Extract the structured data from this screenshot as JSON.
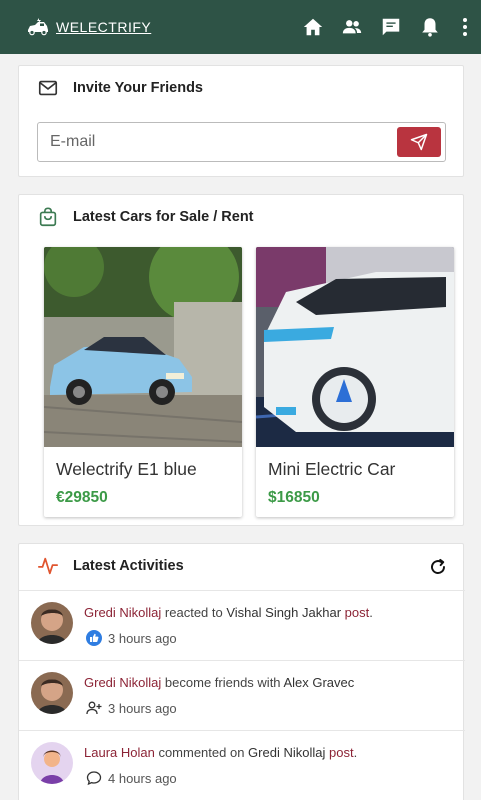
{
  "brand": {
    "name": "WELECTRIFY",
    "logo": "electric-car-logo"
  },
  "nav": {
    "icons": [
      "home-icon",
      "friends-icon",
      "messages-icon",
      "notifications-icon",
      "more-vertical-icon"
    ]
  },
  "invite": {
    "title": "Invite Your Friends",
    "icon": "envelope-icon",
    "email_placeholder": "E-mail",
    "send_icon": "send-icon"
  },
  "cars": {
    "title": "Latest Cars for Sale / Rent",
    "icon": "shopping-bag-icon",
    "items": [
      {
        "name": "Welectrify E1 blue",
        "price": "€29850"
      },
      {
        "name": "Mini Electric Car",
        "price": "$16850"
      }
    ]
  },
  "activities": {
    "title": "Latest Activities",
    "icon": "activity-pulse-icon",
    "refresh_icon": "refresh-icon",
    "items": [
      {
        "actor": "Gredi Nikollaj",
        "verb": " reacted to ",
        "target": "Vishal Singh Jakhar",
        "object": "post",
        "end": ".",
        "time": "3 hours ago",
        "meta_icon": "like-icon"
      },
      {
        "actor": "Gredi Nikollaj",
        "verb": " become friends with ",
        "target": "Alex Gravec",
        "object": "",
        "end": "",
        "time": "3 hours ago",
        "meta_icon": "add-friend-icon"
      },
      {
        "actor": "Laura Holan",
        "verb": " commented on ",
        "target": "Gredi Nikollaj",
        "object": "post",
        "end": ".",
        "time": "4 hours ago",
        "meta_icon": "comment-icon"
      }
    ]
  },
  "colors": {
    "header": "#2e5346",
    "accent_red": "#b9343f",
    "price_green": "#3c9a47",
    "link_red": "#8c2436"
  }
}
